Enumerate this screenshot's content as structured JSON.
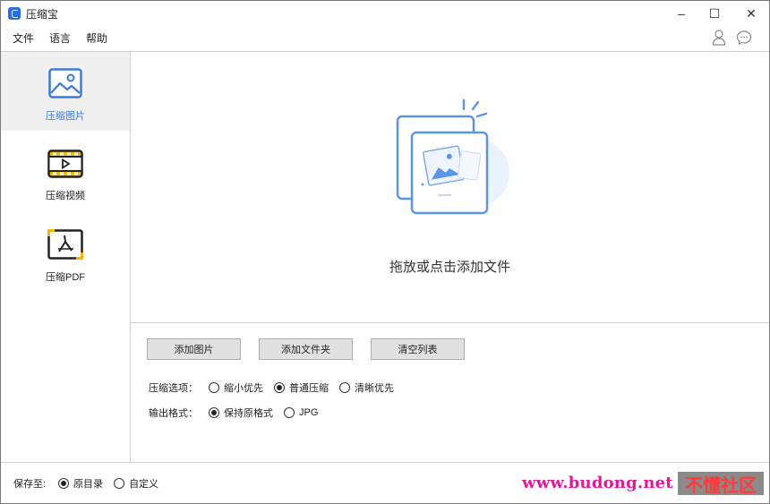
{
  "window": {
    "title": "压缩宝",
    "minimize": "–",
    "maximize": "☐",
    "close": "✕"
  },
  "menu": [
    "文件",
    "语言",
    "帮助"
  ],
  "header_icons": [
    "user-icon",
    "chat-icon"
  ],
  "sidebar": {
    "items": [
      {
        "label": "压缩图片",
        "icon": "image-icon",
        "active": true
      },
      {
        "label": "压缩视频",
        "icon": "video-icon",
        "active": false
      },
      {
        "label": "压缩PDF",
        "icon": "pdf-icon",
        "active": false
      }
    ]
  },
  "dropzone": {
    "text": "拖放或点击添加文件",
    "icon": "add-image-illustration"
  },
  "actions": {
    "add_images": "添加图片",
    "add_folder": "添加文件夹",
    "clear_list": "清空列表"
  },
  "options": {
    "compress_label": "压缩选项：",
    "compress_choices": [
      {
        "label": "缩小优先",
        "checked": false
      },
      {
        "label": "普通压缩",
        "checked": true
      },
      {
        "label": "清晰优先",
        "checked": false
      }
    ],
    "format_label": "输出格式：",
    "format_choices": [
      {
        "label": "保持原格式",
        "checked": true
      },
      {
        "label": "JPG",
        "checked": false
      }
    ]
  },
  "footer": {
    "save_label": "保存至:",
    "save_choices": [
      {
        "label": "原目录",
        "checked": true
      },
      {
        "label": "自定义",
        "checked": false
      }
    ]
  },
  "watermark": {
    "url": "www.budong.net",
    "text": "不懂社区"
  },
  "colors": {
    "accent": "#3b7bd8",
    "icon_yellow": "#f5b800",
    "watermark_pink": "#e0189a"
  }
}
